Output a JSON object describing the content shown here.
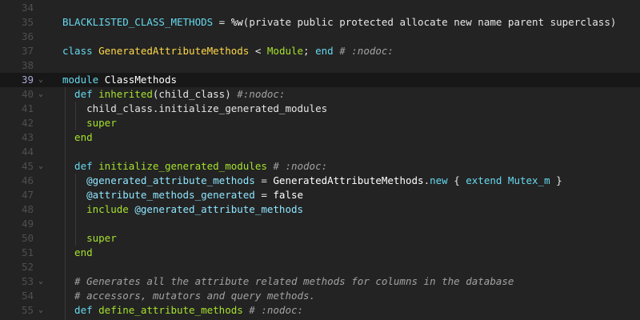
{
  "editor": {
    "current_line": "39",
    "lines": [
      {
        "n": "34",
        "segments": []
      },
      {
        "n": "35",
        "segments": [
          {
            "t": "BLACKLISTED_CLASS_METHODS",
            "c": "kw"
          },
          {
            "t": " = ",
            "c": "sym"
          },
          {
            "t": "%w",
            "c": "bool"
          },
          {
            "t": "(private public protected allocate new name parent superclass)",
            "c": "str"
          }
        ]
      },
      {
        "n": "36",
        "segments": []
      },
      {
        "n": "37",
        "segments": [
          {
            "t": "class ",
            "c": "kw"
          },
          {
            "t": "GeneratedAttributeMethods",
            "c": "cls"
          },
          {
            "t": " < ",
            "c": "sym"
          },
          {
            "t": "Module",
            "c": "con"
          },
          {
            "t": "; ",
            "c": "sym"
          },
          {
            "t": "end",
            "c": "kw"
          },
          {
            "t": " # :nodoc:",
            "c": "cm"
          }
        ]
      },
      {
        "n": "38",
        "segments": []
      },
      {
        "n": "39",
        "fold": "⌄",
        "segments": [
          {
            "t": "module ",
            "c": "kw"
          },
          {
            "t": "ClassMethods",
            "c": "bool"
          }
        ]
      },
      {
        "n": "40",
        "fold": "⌄",
        "segments": [
          {
            "t": "  def ",
            "c": "kw"
          },
          {
            "t": "inherited",
            "c": "con"
          },
          {
            "t": "(child_class) ",
            "c": "sym"
          },
          {
            "t": "#:nodoc:",
            "c": "cm"
          }
        ]
      },
      {
        "n": "41",
        "segments": [
          {
            "t": "    child_class.initialize_generated_modules",
            "c": "sym"
          }
        ]
      },
      {
        "n": "42",
        "segments": [
          {
            "t": "    super",
            "c": "con"
          }
        ]
      },
      {
        "n": "43",
        "segments": [
          {
            "t": "  end",
            "c": "con"
          }
        ]
      },
      {
        "n": "44",
        "segments": []
      },
      {
        "n": "45",
        "fold": "⌄",
        "segments": [
          {
            "t": "  def ",
            "c": "kw"
          },
          {
            "t": "initialize_generated_modules",
            "c": "con"
          },
          {
            "t": " # :nodoc:",
            "c": "cm"
          }
        ]
      },
      {
        "n": "46",
        "segments": [
          {
            "t": "    @generated_attribute_methods",
            "c": "ivar"
          },
          {
            "t": " = ",
            "c": "sym"
          },
          {
            "t": "GeneratedAttributeMethods",
            "c": "bool"
          },
          {
            "t": ".",
            "c": "sym"
          },
          {
            "t": "new",
            "c": "kw"
          },
          {
            "t": " { ",
            "c": "sym"
          },
          {
            "t": "extend Mutex_m",
            "c": "kw"
          },
          {
            "t": " }",
            "c": "sym"
          }
        ]
      },
      {
        "n": "47",
        "segments": [
          {
            "t": "    @attribute_methods_generated",
            "c": "ivar"
          },
          {
            "t": " = ",
            "c": "sym"
          },
          {
            "t": "false",
            "c": "bool"
          }
        ]
      },
      {
        "n": "48",
        "segments": [
          {
            "t": "    include ",
            "c": "con"
          },
          {
            "t": "@generated_attribute_methods",
            "c": "ivar"
          }
        ]
      },
      {
        "n": "49",
        "segments": []
      },
      {
        "n": "50",
        "segments": [
          {
            "t": "    super",
            "c": "con"
          }
        ]
      },
      {
        "n": "51",
        "segments": [
          {
            "t": "  end",
            "c": "con"
          }
        ]
      },
      {
        "n": "52",
        "segments": []
      },
      {
        "n": "53",
        "fold": "⌄",
        "segments": [
          {
            "t": "  # Generates all the attribute related methods for columns in the database",
            "c": "cm"
          }
        ]
      },
      {
        "n": "54",
        "segments": [
          {
            "t": "  # accessors, mutators and query methods.",
            "c": "cm"
          }
        ]
      },
      {
        "n": "55",
        "fold": "⌄",
        "segments": [
          {
            "t": "  def ",
            "c": "kw"
          },
          {
            "t": "define_attribute_methods",
            "c": "con"
          },
          {
            "t": " # :nodoc:",
            "c": "cm"
          }
        ]
      }
    ]
  }
}
